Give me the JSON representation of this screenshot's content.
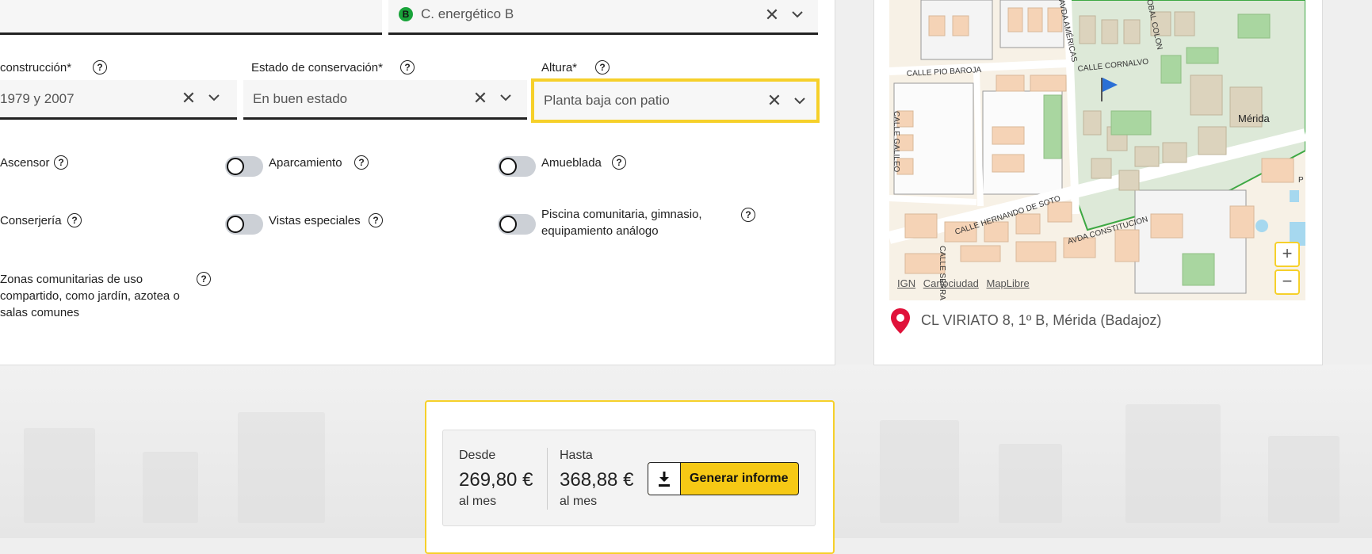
{
  "energy": {
    "badge": "B",
    "value": "C. energético B"
  },
  "fields": {
    "construction": {
      "label": "construcción*",
      "value": "1979 y 2007"
    },
    "conservation": {
      "label": "Estado de conservación*",
      "value": "En buen estado"
    },
    "height": {
      "label": "Altura*",
      "value": "Planta baja con patio"
    }
  },
  "help_glyph": "?",
  "toggles": {
    "ascensor": "Ascensor",
    "aparcamiento": "Aparcamiento",
    "amueblada": "Amueblada",
    "conserjeria": "Conserjería",
    "vistas": "Vistas especiales",
    "piscina_line1": "Piscina comunitaria, gimnasio,",
    "piscina_line2": "equipamiento análogo",
    "zonas_line1": "Zonas comunitarias de uso",
    "zonas_line2": "compartido, como jardín, azotea o",
    "zonas_line3": "salas comunes"
  },
  "map": {
    "streets": {
      "pio_baroja": "CALLE PIO BAROJA",
      "cornalvo": "CALLE CORNALVO",
      "galileo": "CALLE GALILEO",
      "hernando": "CALLE HERNANDO DE SOTO",
      "constitucion": "AVDA CONSTITUCION",
      "americas": "AVDA AMÉRICAS",
      "colon": "OBAL COLON",
      "serrano": "CALLE SERRANO",
      "city": "Mérida",
      "p_partial": "P"
    },
    "zoom_in": "+",
    "zoom_out": "−",
    "attribution": [
      "IGN",
      "Cartociudad",
      "MapLibre"
    ],
    "address": "CL VIRIATO 8, 1º B, Mérida (Badajoz)"
  },
  "result": {
    "from_label": "Desde",
    "from_value": "269,80 €",
    "from_unit": "al mes",
    "to_label": "Hasta",
    "to_value": "368,88 €",
    "to_unit": "al mes",
    "button": "Generar informe"
  },
  "colors": {
    "accent": "#f6d02a",
    "button": "#f6c915",
    "pin": "#e0123a",
    "energy_b": "#19a33a",
    "flag": "#2a6fd6"
  }
}
